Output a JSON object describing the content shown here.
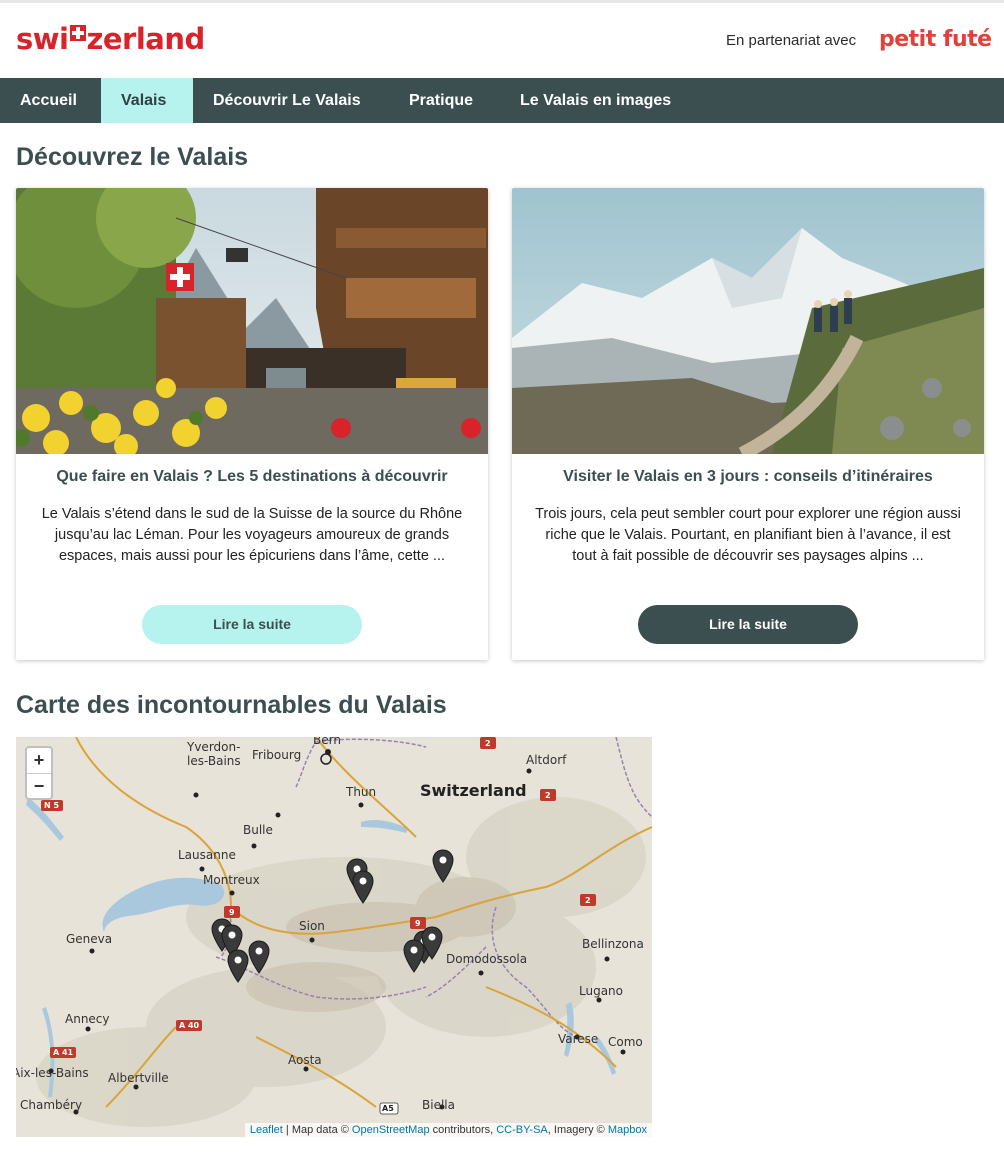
{
  "header": {
    "logo_text": "switzerland",
    "partner_text": "En partenariat avec",
    "partner_logo": "petit futé"
  },
  "nav": {
    "items": [
      {
        "label": "Accueil"
      },
      {
        "label": "Valais"
      },
      {
        "label": "Découvrir Le Valais"
      },
      {
        "label": "Pratique"
      },
      {
        "label": "Le Valais en images"
      }
    ],
    "active_index": 1
  },
  "section1": {
    "title": "Découvrez le Valais"
  },
  "cards": [
    {
      "title": "Que faire en Valais ? Les 5 destinations à découvrir",
      "description": "Le Valais s’étend dans le sud de la Suisse de la source du Rhône jusqu’au lac Léman. Pour les voyageurs amoureux de grands espaces, mais aussi pour les épicuriens dans l’âme, cette ...",
      "button": "Lire la suite"
    },
    {
      "title": "Visiter le Valais en 3 jours : conseils d’itinéraires",
      "description": "Trois jours, cela peut sembler court pour explorer une région aussi riche que le Valais. Pourtant, en planifiant bien à l’avance, il est tout à fait possible de découvrir ses paysages alpins ...",
      "button": "Lire la suite"
    }
  ],
  "section2": {
    "title": "Carte des incontournables du Valais"
  },
  "map": {
    "zoom_in": "+",
    "zoom_out": "−",
    "country_label": "Switzerland",
    "places": [
      "Bern",
      "Altdorf",
      "Yverdon-les-Bains",
      "Fribourg",
      "Thun",
      "Bulle",
      "Lausanne",
      "Montreux",
      "Geneva",
      "Sion",
      "Bellinzona",
      "Domodossola",
      "Lugano",
      "Annecy",
      "Varese",
      "Como",
      "Aix-les-Bains",
      "Albertville",
      "Aosta",
      "Chambéry",
      "Biella"
    ],
    "road_shields": [
      "2",
      "N 5",
      "2",
      "9",
      "2",
      "9",
      "A 40",
      "A 41",
      "A5"
    ],
    "marker_count": 10,
    "attribution": {
      "leaflet": "Leaflet",
      "sep": " | Map data © ",
      "osm": "OpenStreetMap",
      "contrib": " contributors, ",
      "ccbysa": "CC-BY-SA",
      "imagery": ", Imagery © ",
      "mapbox": "Mapbox"
    }
  }
}
